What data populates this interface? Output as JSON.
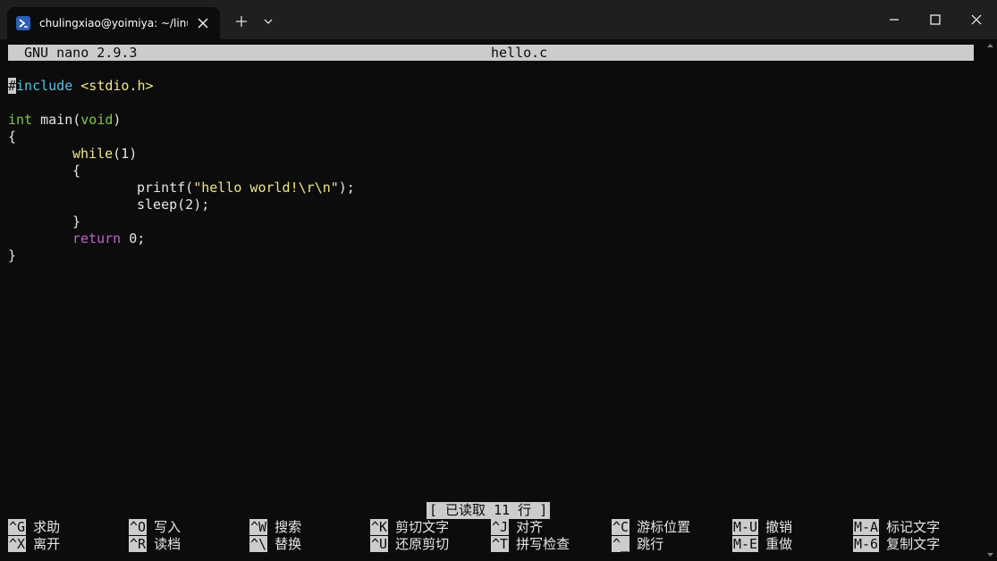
{
  "window": {
    "tab_title": "chulingxiao@yoimiya: ~/linux"
  },
  "nano": {
    "version": "GNU nano 2.9.3",
    "filename": "hello.c",
    "status_message": "[ 已读取 11 行 ]"
  },
  "code": {
    "l1_hash": "#",
    "l1_include": "include",
    "l1_header": "<stdio.h>",
    "l3_type": "int",
    "l3_name": " main(",
    "l3_void": "void",
    "l3_close": ")",
    "l4": "{",
    "l5_kw": "while",
    "l5_rest": "(1)",
    "l6": "{",
    "l7_func": "printf(",
    "l7_str1": "\"hello world!",
    "l7_esc1": "\\r",
    "l7_esc2": "\\n",
    "l7_str2": "\"",
    "l7_end": ");",
    "l8": "sleep(2);",
    "l9": "}",
    "l10_kw": "return",
    "l10_rest": " 0;",
    "l11": "}"
  },
  "shortcuts": [
    {
      "key": "^G",
      "label": "求助"
    },
    {
      "key": "^O",
      "label": "写入"
    },
    {
      "key": "^W",
      "label": "搜索"
    },
    {
      "key": "^K",
      "label": "剪切文字"
    },
    {
      "key": "^J",
      "label": "对齐"
    },
    {
      "key": "^C",
      "label": "游标位置"
    },
    {
      "key": "M-U",
      "label": "撤销"
    },
    {
      "key": "M-A",
      "label": "标记文字"
    },
    {
      "key": "^X",
      "label": "离开"
    },
    {
      "key": "^R",
      "label": "读档"
    },
    {
      "key": "^\\",
      "label": "替换"
    },
    {
      "key": "^U",
      "label": "还原剪切"
    },
    {
      "key": "^T",
      "label": "拼写检查"
    },
    {
      "key": "^_",
      "label": "跳行"
    },
    {
      "key": "M-E",
      "label": "重做"
    },
    {
      "key": "M-6",
      "label": "复制文字"
    }
  ],
  "colors": {
    "background": "#0c0c0c",
    "titlebar": "#1f1f1f",
    "highlight": "#cccccc"
  }
}
